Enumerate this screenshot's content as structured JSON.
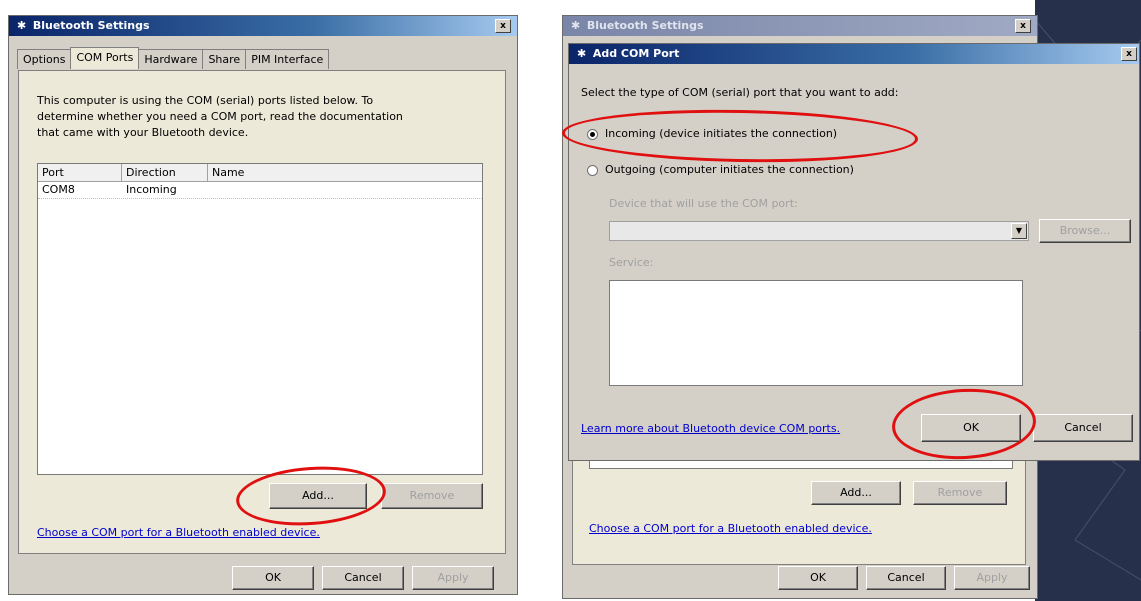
{
  "left": {
    "title": "Bluetooth Settings",
    "close": "x",
    "tabs": [
      "Options",
      "COM Ports",
      "Hardware",
      "Share",
      "PIM Interface"
    ],
    "active_tab": "COM Ports",
    "description": [
      "This computer is using the COM (serial) ports listed below. To",
      "determine whether you need a COM port, read the documentation",
      "that came with your Bluetooth device."
    ],
    "columns": [
      "Port",
      "Direction",
      "Name"
    ],
    "rows": [
      {
        "port": "COM8",
        "direction": "Incoming",
        "name": ""
      }
    ],
    "add_label": "Add...",
    "remove_label": "Remove",
    "link": "Choose a COM port for a Bluetooth enabled device.",
    "ok_label": "OK",
    "cancel_label": "Cancel",
    "apply_label": "Apply"
  },
  "right": {
    "back_title": "Bluetooth Settings",
    "dialog_title": "Add COM Port",
    "close": "x",
    "instruction": "Select the type of COM (serial) port that you want to add:",
    "radio_incoming": "Incoming (device initiates the connection)",
    "radio_outgoing": "Outgoing (computer initiates the connection)",
    "selected": "incoming",
    "device_label": "Device that will use the COM port:",
    "browse_label": "Browse...",
    "service_label": "Service:",
    "learn_link": "Learn more about Bluetooth device COM ports.",
    "ok_label": "OK",
    "cancel_label": "Cancel",
    "behind_add_label": "Add...",
    "behind_remove_label": "Remove",
    "behind_link": "Choose a COM port for a Bluetooth enabled device.",
    "behind_ok_label": "OK",
    "behind_cancel_label": "Cancel",
    "behind_apply_label": "Apply"
  },
  "colors": {
    "highlight_ellipse": "#e01010",
    "title_gradient_start": "#0a246a",
    "link": "#0000cc"
  }
}
